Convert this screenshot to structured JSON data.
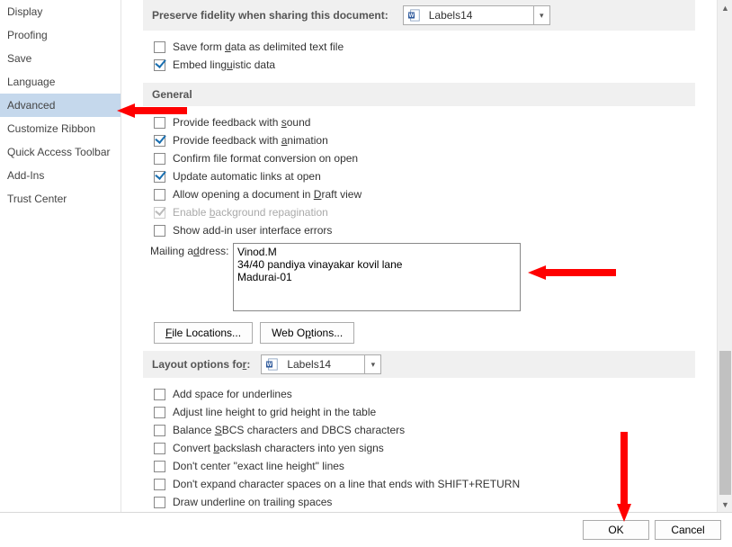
{
  "sidebar": {
    "items": [
      {
        "label": "Display"
      },
      {
        "label": "Proofing"
      },
      {
        "label": "Save"
      },
      {
        "label": "Language"
      },
      {
        "label": "Advanced",
        "selected": true
      },
      {
        "label": "Customize Ribbon"
      },
      {
        "label": "Quick Access Toolbar"
      },
      {
        "label": "Add-Ins"
      },
      {
        "label": "Trust Center"
      }
    ]
  },
  "preserve": {
    "label": "Preserve fidelity when sharing this document:",
    "doc": "Labels14"
  },
  "fidelity_opts": [
    {
      "label": "Save form data as delimited text file",
      "checked": false,
      "u": "d"
    },
    {
      "label": "Embed linguistic data",
      "checked": true,
      "u": "u"
    }
  ],
  "general": {
    "header": "General",
    "opts": [
      {
        "label": "Provide feedback with sound",
        "checked": false,
        "u": "s"
      },
      {
        "label": "Provide feedback with animation",
        "checked": true,
        "u": "a"
      },
      {
        "label": "Confirm file format conversion on open",
        "checked": false
      },
      {
        "label": "Update automatic links at open",
        "checked": true
      },
      {
        "label": "Allow opening a document in Draft view",
        "checked": false,
        "u": "D"
      },
      {
        "label": "Enable background repagination",
        "checked": true,
        "disabled": true,
        "u": "b"
      },
      {
        "label": "Show add-in user interface errors",
        "checked": false
      }
    ],
    "mailing_label": "Mailing address:",
    "mailing_value": "Vinod.M\n34/40 pandiya vinayakar kovil lane\nMadurai-01",
    "file_locations": "File Locations...",
    "web_options": "Web Options..."
  },
  "layout": {
    "label": "Layout options for:",
    "doc": "Labels14",
    "opts": [
      {
        "label": "Add space for underlines",
        "checked": false
      },
      {
        "label": "Adjust line height to grid height in the table",
        "checked": false
      },
      {
        "label": "Balance SBCS characters and DBCS characters",
        "checked": false,
        "u": "S"
      },
      {
        "label": "Convert backslash characters into yen signs",
        "checked": false,
        "u": "b"
      },
      {
        "label": "Don't center \"exact line height\" lines",
        "checked": false
      },
      {
        "label": "Don't expand character spaces on a line that ends with SHIFT+RETURN",
        "checked": false
      },
      {
        "label": "Draw underline on trailing spaces",
        "checked": false
      }
    ]
  },
  "footer": {
    "ok": "OK",
    "cancel": "Cancel"
  }
}
